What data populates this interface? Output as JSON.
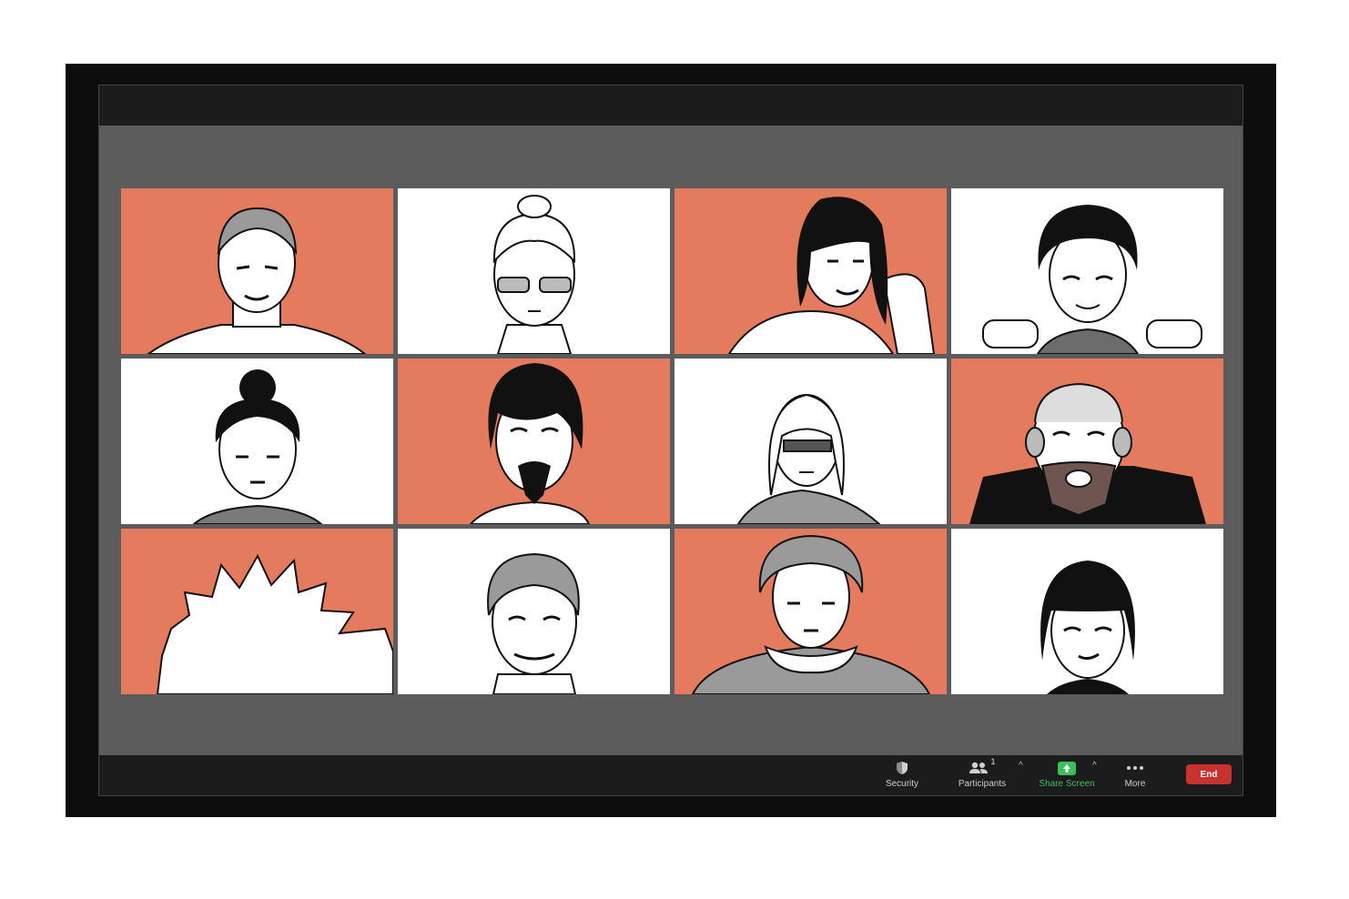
{
  "colors": {
    "accent_tile": "#e57b5e",
    "white_tile": "#ffffff",
    "share_green": "#39c15a",
    "end_red": "#c7322e"
  },
  "participants": [
    {
      "bg": "#e57b5e"
    },
    {
      "bg": "#ffffff"
    },
    {
      "bg": "#e57b5e"
    },
    {
      "bg": "#ffffff"
    },
    {
      "bg": "#ffffff"
    },
    {
      "bg": "#e57b5e"
    },
    {
      "bg": "#ffffff"
    },
    {
      "bg": "#e57b5e"
    },
    {
      "bg": "#e57b5e"
    },
    {
      "bg": "#ffffff"
    },
    {
      "bg": "#e57b5e"
    },
    {
      "bg": "#ffffff"
    }
  ],
  "toolbar": {
    "security_label": "Security",
    "security_icon": "shield-icon",
    "participants_label": "Participants",
    "participants_count": "1",
    "participants_icon": "people-icon",
    "share_label": "Share Screen",
    "share_icon": "share-arrow-icon",
    "more_label": "More",
    "more_icon": "ellipsis-icon",
    "end_label": "End"
  }
}
